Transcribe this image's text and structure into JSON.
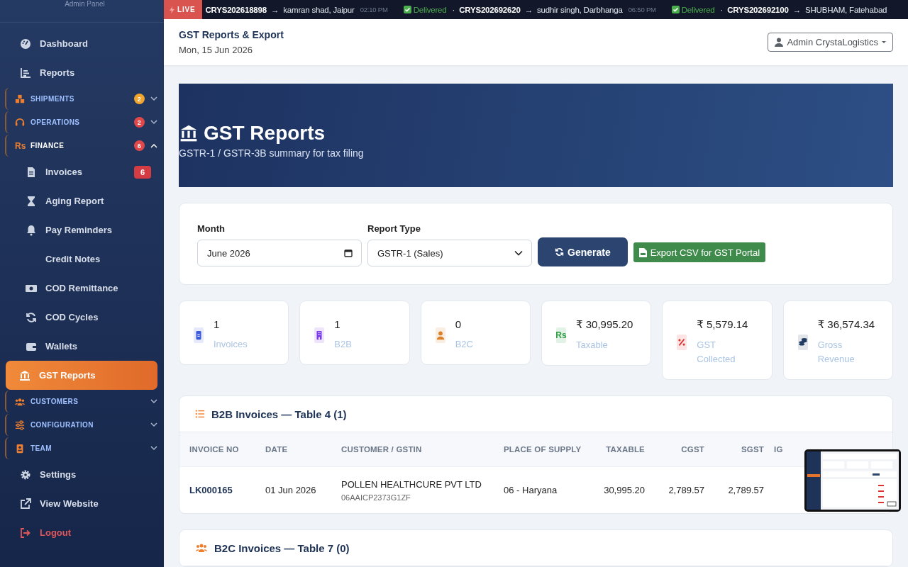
{
  "sidebar": {
    "caption": "Admin Panel",
    "items": [
      {
        "kind": "link",
        "label": "Dashboard",
        "selected": false
      },
      {
        "kind": "link",
        "label": "Reports",
        "selected": false
      },
      {
        "kind": "group",
        "label": "SHIPMENTS",
        "badge": "2",
        "color": "#f0a52c",
        "expanded": false
      },
      {
        "kind": "group",
        "label": "OPERATIONS",
        "badge": "2",
        "color": "#e0484a",
        "expanded": false
      },
      {
        "kind": "group",
        "label": "FINANCE",
        "icon_text": "Rs",
        "badge": "6",
        "color": "#e0484a",
        "expanded": true,
        "children": [
          {
            "label": "Invoices",
            "badge": "6",
            "selected": false
          },
          {
            "label": "Aging Report",
            "selected": false
          },
          {
            "label": "Pay Reminders",
            "selected": false
          },
          {
            "label": "Credit Notes",
            "selected": false
          },
          {
            "label": "COD Remittance",
            "selected": false
          },
          {
            "label": "COD Cycles",
            "selected": false
          },
          {
            "label": "Wallets",
            "selected": false
          },
          {
            "label": "GST Reports",
            "selected": true
          }
        ]
      },
      {
        "kind": "group",
        "label": "CUSTOMERS",
        "expanded": false
      },
      {
        "kind": "group",
        "label": "CONFIGURATION",
        "expanded": false
      },
      {
        "kind": "group",
        "label": "TEAM",
        "expanded": false
      },
      {
        "kind": "link",
        "label": "Settings",
        "selected": false
      },
      {
        "kind": "link",
        "label": "View Website",
        "selected": false
      },
      {
        "kind": "danger",
        "label": "Logout",
        "selected": false
      }
    ]
  },
  "ticker": {
    "badge": "LIVE",
    "items": [
      {
        "id": "CRYS202618898",
        "arrow": "→",
        "dest": "kamran shad, Jaipur",
        "time": "02:10 PM",
        "status": "Delivered"
      },
      {
        "sep": "·",
        "id": "CRYS202692620",
        "arrow": "→",
        "dest": "sudhir singh, Darbhanga",
        "time": "06:50 PM",
        "status": "Delivered"
      },
      {
        "sep": "·",
        "id": "CRYS202692100",
        "arrow": "→",
        "dest": "SHUBHAM, Fatehabad"
      }
    ]
  },
  "header": {
    "title": "GST Reports & Export",
    "date": "Mon, 15 Jun 2026",
    "user": "Admin CrystaLogistics"
  },
  "banner": {
    "title": "GST Reports",
    "subtitle": "GSTR-1 / GSTR-3B summary for tax filing"
  },
  "filters": {
    "month_label": "Month",
    "month": "June 2026",
    "type_label": "Report Type",
    "type": "GSTR-1 (Sales)",
    "generate": "Generate",
    "export": "Export CSV for GST Portal"
  },
  "stats": [
    {
      "value": "1",
      "label": "Invoices",
      "color": "#3b5bdb"
    },
    {
      "value": "1",
      "label": "B2B",
      "color": "#7c3aed"
    },
    {
      "value": "0",
      "label": "B2C",
      "color": "#d9822b"
    },
    {
      "value": "₹ 30,995.20",
      "label": "Taxable",
      "color": "#2f9e44",
      "icon_text": "Rs"
    },
    {
      "value": "₹ 5,579.14",
      "label": "GST Collected",
      "color": "#e03131"
    },
    {
      "value": "₹ 36,574.34",
      "label": "Gross Revenue",
      "color": "#1e3a5f"
    }
  ],
  "b2b": {
    "title": "B2B Invoices — Table 4 (1)",
    "columns": [
      "INVOICE NO",
      "DATE",
      "CUSTOMER / GSTIN",
      "PLACE OF SUPPLY",
      "TAXABLE",
      "CGST",
      "SGST",
      "IG"
    ],
    "rows": [
      {
        "invoice": "LK000165",
        "date": "01 Jun 2026",
        "customer": "POLLEN HEALTHCURE PVT LTD",
        "gstin": "06AAICP2373G1ZF",
        "place": "06 - Haryana",
        "taxable": "30,995.20",
        "cgst": "2,789.57",
        "sgst": "2,789.57"
      }
    ]
  },
  "b2c": {
    "title": "B2C Invoices — Table 7 (0)"
  }
}
